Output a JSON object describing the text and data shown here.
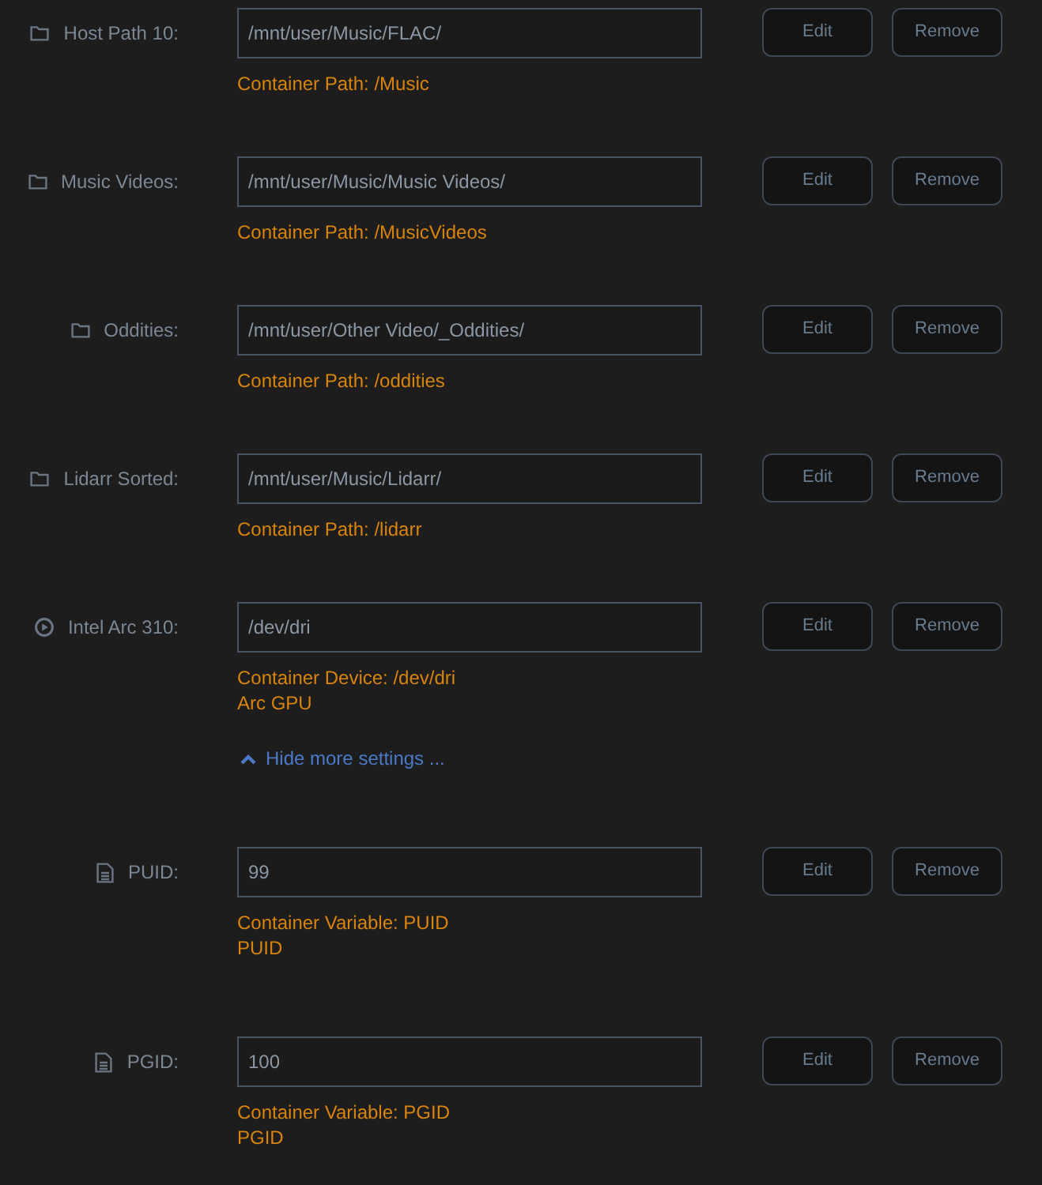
{
  "items": [
    {
      "kind": "path",
      "label": "Host Path 10:",
      "value": "/mnt/user/Music/FLAC/",
      "notes": [
        "Container Path: /Music"
      ],
      "buttons": [
        "Edit",
        "Remove"
      ]
    },
    {
      "kind": "path",
      "label": "Music Videos:",
      "value": "/mnt/user/Music/Music Videos/",
      "notes": [
        "Container Path: /MusicVideos"
      ],
      "buttons": [
        "Edit",
        "Remove"
      ]
    },
    {
      "kind": "path",
      "label": "Oddities:",
      "value": "/mnt/user/Other Video/_Oddities/",
      "notes": [
        "Container Path: /oddities"
      ],
      "buttons": [
        "Edit",
        "Remove"
      ]
    },
    {
      "kind": "path",
      "label": "Lidarr Sorted:",
      "value": "/mnt/user/Music/Lidarr/",
      "notes": [
        "Container Path: /lidarr"
      ],
      "buttons": [
        "Edit",
        "Remove"
      ]
    },
    {
      "kind": "device",
      "label": "Intel Arc 310:",
      "value": "/dev/dri",
      "notes": [
        "Container Device: /dev/dri",
        "Arc GPU"
      ],
      "buttons": [
        "Edit",
        "Remove"
      ]
    },
    {
      "kind": "toggle",
      "label": "Hide more settings ...",
      "expanded": true
    },
    {
      "kind": "variable",
      "label": "PUID:",
      "value": "99",
      "notes": [
        "Container Variable: PUID",
        "PUID"
      ],
      "buttons": [
        "Edit",
        "Remove"
      ]
    },
    {
      "kind": "variable",
      "label": "PGID:",
      "value": "100",
      "notes": [
        "Container Variable: PGID",
        "PGID"
      ],
      "buttons": [
        "Edit",
        "Remove"
      ]
    }
  ]
}
